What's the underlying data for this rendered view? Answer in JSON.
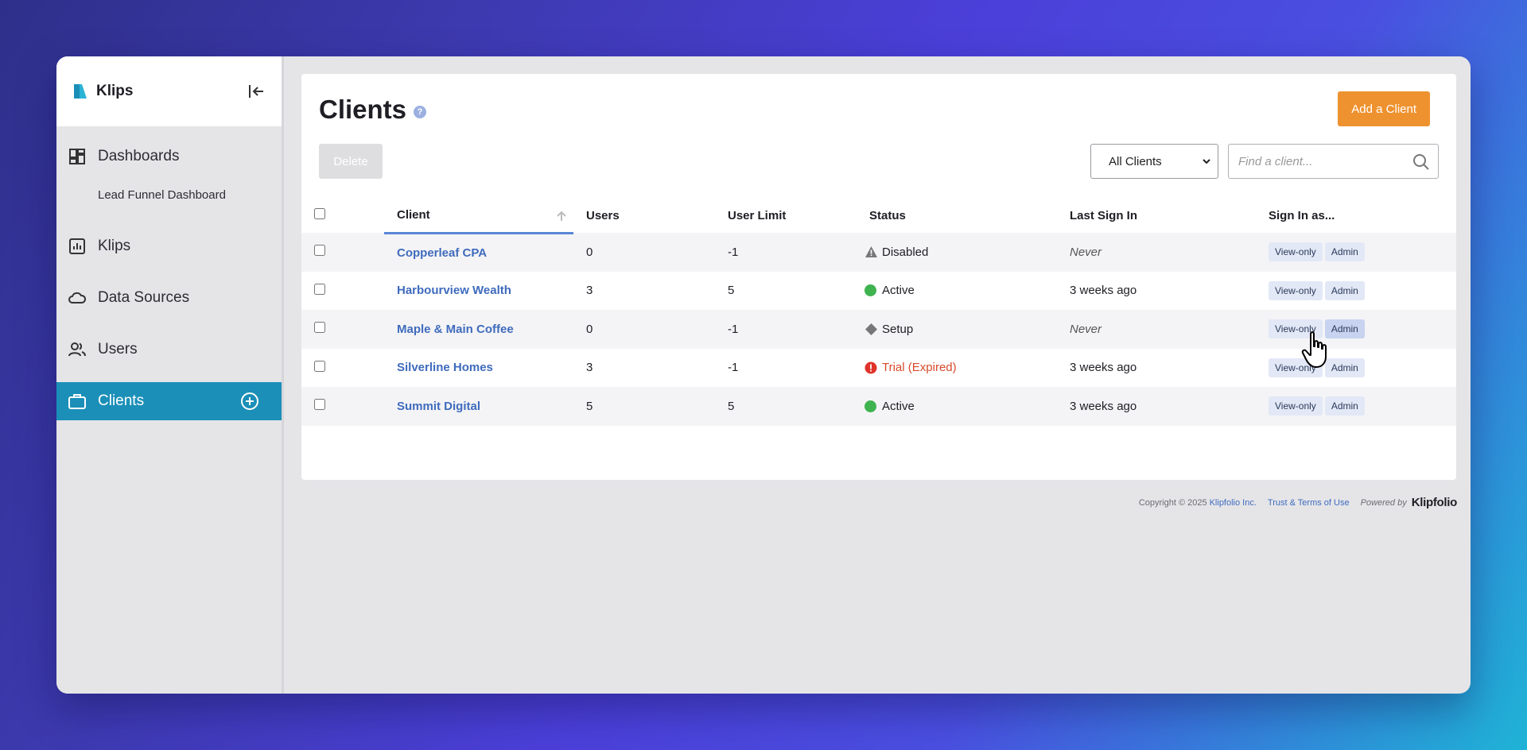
{
  "app": {
    "name": "Klips",
    "brand_color": "#1b8fb8",
    "accent_color": "#ee922f"
  },
  "sidebar": {
    "items": [
      {
        "label": "Dashboards",
        "icon": "dashboard-icon"
      },
      {
        "label": "Lead Funnel Dashboard",
        "sub": true
      },
      {
        "label": "Klips",
        "icon": "bar-chart-icon"
      },
      {
        "label": "Data Sources",
        "icon": "cloud-icon"
      },
      {
        "label": "Users",
        "icon": "users-icon"
      },
      {
        "label": "Clients",
        "icon": "briefcase-icon",
        "active": true
      }
    ]
  },
  "page": {
    "title": "Clients",
    "add_button": "Add a Client",
    "delete_button": "Delete",
    "filter_value": "All Clients",
    "search_placeholder": "Find a client..."
  },
  "table": {
    "headers": [
      "Client",
      "Users",
      "User Limit",
      "Status",
      "Last Sign In",
      "Sign In as..."
    ],
    "rows": [
      {
        "client": "Copperleaf CPA",
        "users": "0",
        "limit": "-1",
        "status": "Disabled",
        "status_icon": "warning-icon",
        "last": "Never"
      },
      {
        "client": "Harbourview Wealth",
        "users": "3",
        "limit": "5",
        "status": "Active",
        "status_icon": "green-dot-icon",
        "last": "3 weeks ago"
      },
      {
        "client": "Maple & Main Coffee",
        "users": "0",
        "limit": "-1",
        "status": "Setup",
        "status_icon": "diamond-icon",
        "last": "Never"
      },
      {
        "client": "Silverline Homes",
        "users": "3",
        "limit": "-1",
        "status": "Trial (Expired)",
        "status_icon": "error-icon",
        "last": "3 weeks ago"
      },
      {
        "client": "Summit Digital",
        "users": "5",
        "limit": "5",
        "status": "Active",
        "status_icon": "green-dot-icon",
        "last": "3 weeks ago"
      }
    ],
    "view_label": "View-only",
    "admin_label": "Admin"
  },
  "footer": {
    "copyright": "Copyright © 2025",
    "company": "Klipfolio Inc.",
    "terms": "Trust & Terms of Use",
    "powered": "Powered by",
    "logo": "Klipfolio"
  }
}
